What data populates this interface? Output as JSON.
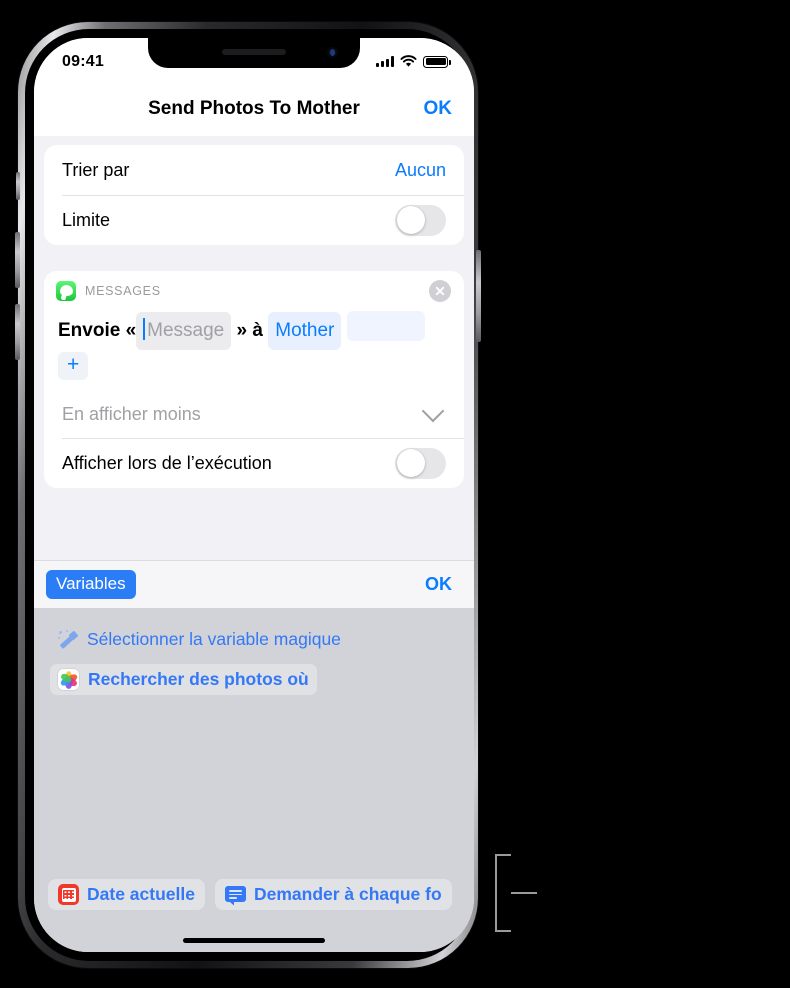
{
  "status_bar": {
    "time": "09:41",
    "cellular_icon": "signal-bars-icon",
    "wifi_icon": "wifi-icon",
    "battery_icon": "battery-full-icon"
  },
  "nav_bar": {
    "title": "Send Photos To Mother",
    "done_label": "OK"
  },
  "options_card": {
    "rows": [
      {
        "label": "Trier par",
        "value": "Aucun",
        "type": "value"
      },
      {
        "label": "Limite",
        "value": "",
        "type": "toggle",
        "toggle_on": false
      }
    ]
  },
  "action_card": {
    "app_name": "MESSAGES",
    "app_icon": "messages-app-icon",
    "close_icon": "close-circle-icon",
    "sentence": {
      "prefix": "Envoie «",
      "message_placeholder": "Message",
      "middle": "» à",
      "recipient": "Mother",
      "trailing_empty_token": ""
    },
    "add_button_label": "+",
    "show_less_label": "En afficher moins",
    "show_less_icon": "chevron-down-icon",
    "show_when_run": {
      "label": "Afficher lors de l’exécution",
      "toggle_on": false
    }
  },
  "variables_bar": {
    "chip_label": "Variables",
    "done_label": "OK"
  },
  "variable_picker": {
    "items": [
      {
        "label": "Sélectionner la variable magique",
        "icon": "magic-wand-icon",
        "selected": false
      },
      {
        "label": "Rechercher des photos où",
        "icon": "photos-app-icon",
        "selected": true
      }
    ]
  },
  "bottom_variables": [
    {
      "label": "Date actuelle",
      "icon": "calendar-icon"
    },
    {
      "label": "Demander à chaque fo",
      "icon": "message-bubble-icon"
    }
  ],
  "colors": {
    "accent_blue": "#0a7cff",
    "chip_blue": "#2b7df5",
    "panel_gray": "#d1d3d8",
    "content_gray": "#f2f2f6",
    "messages_green": "#1cc63c",
    "calendar_red": "#f0392b"
  }
}
